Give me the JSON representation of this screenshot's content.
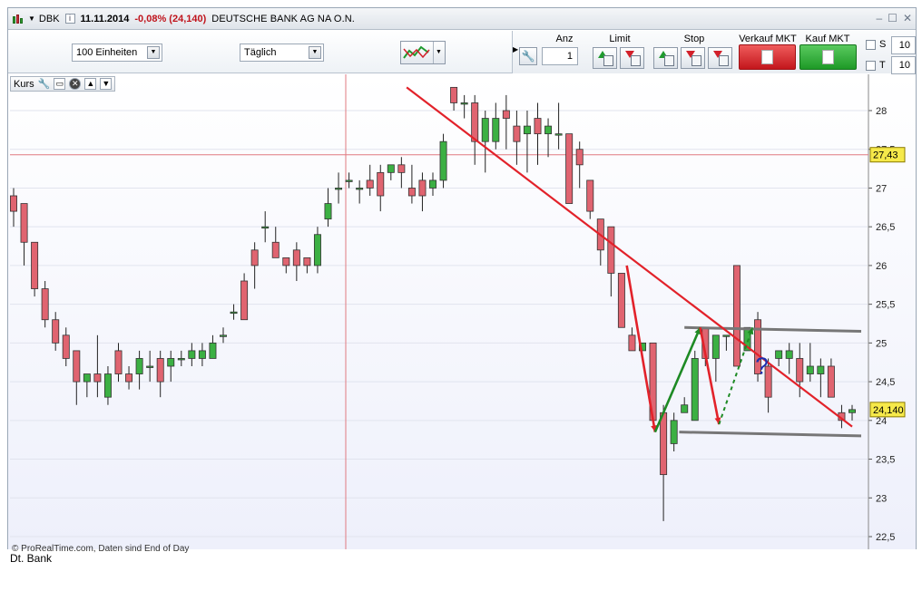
{
  "window": {
    "symbol": "DBK",
    "date": "11.11.2014",
    "change": "-0,08% (24,140)",
    "name": "DEUTSCHE BANK AG NA O.N."
  },
  "toolbar": {
    "quantity_select": "100 Einheiten",
    "interval_select": "Täglich",
    "anz_label": "Anz",
    "anz_value": "1",
    "limit_label": "Limit",
    "stop_label": "Stop",
    "sell_label": "Verkauf MKT",
    "buy_label": "Kauf MKT",
    "s_label": "S",
    "s_value": "10",
    "t_label": "T",
    "t_value": "10"
  },
  "panel": {
    "label": "Kurs"
  },
  "footer": {
    "copyright": "© ProRealTime.com, Daten sind End of Day",
    "caption": "Dt. Bank"
  },
  "colors": {
    "up": "#3cb043",
    "down": "#e06470",
    "trend": "#e2222a",
    "channel": "#777777",
    "pattern_green": "#1d8a24",
    "question": "#1c30b0"
  },
  "chart_data": {
    "type": "candlestick",
    "ylim": [
      22.3,
      28.5
    ],
    "yticks": [
      "28",
      "27,5",
      "27",
      "26,5",
      "26",
      "25,5",
      "25",
      "24,5",
      "24",
      "23,5",
      "23",
      "22,5"
    ],
    "price_labels": [
      "27,43",
      "24,140"
    ],
    "annotation": "?",
    "ohlc": [
      [
        26.9,
        27.0,
        26.5,
        26.7
      ],
      [
        26.8,
        26.8,
        26.0,
        26.3
      ],
      [
        26.3,
        26.3,
        25.6,
        25.7
      ],
      [
        25.7,
        25.8,
        25.2,
        25.3
      ],
      [
        25.3,
        25.4,
        24.9,
        25.0
      ],
      [
        25.1,
        25.2,
        24.7,
        24.8
      ],
      [
        24.9,
        24.9,
        24.2,
        24.5
      ],
      [
        24.5,
        24.6,
        24.3,
        24.6
      ],
      [
        24.6,
        25.1,
        24.3,
        24.5
      ],
      [
        24.3,
        24.7,
        24.2,
        24.6
      ],
      [
        24.9,
        25.0,
        24.5,
        24.6
      ],
      [
        24.6,
        24.7,
        24.4,
        24.5
      ],
      [
        24.6,
        24.9,
        24.4,
        24.8
      ],
      [
        24.7,
        24.9,
        24.5,
        24.7
      ],
      [
        24.8,
        24.9,
        24.3,
        24.5
      ],
      [
        24.7,
        24.9,
        24.5,
        24.8
      ],
      [
        24.8,
        24.9,
        24.7,
        24.8
      ],
      [
        24.8,
        25.0,
        24.7,
        24.9
      ],
      [
        24.8,
        25.0,
        24.7,
        24.9
      ],
      [
        24.8,
        25.1,
        24.8,
        25.0
      ],
      [
        25.1,
        25.2,
        25.0,
        25.1
      ],
      [
        25.4,
        25.5,
        25.3,
        25.4
      ],
      [
        25.8,
        25.9,
        25.3,
        25.3
      ],
      [
        26.2,
        26.3,
        25.7,
        26.0
      ],
      [
        26.5,
        26.7,
        26.3,
        26.5
      ],
      [
        26.3,
        26.5,
        26.1,
        26.1
      ],
      [
        26.1,
        26.1,
        25.9,
        26.0
      ],
      [
        26.2,
        26.3,
        25.8,
        26.0
      ],
      [
        26.1,
        26.1,
        25.9,
        26.0
      ],
      [
        26.0,
        26.5,
        25.9,
        26.4
      ],
      [
        26.6,
        27.0,
        26.5,
        26.8
      ],
      [
        27.0,
        27.2,
        26.8,
        27.0
      ],
      [
        27.1,
        27.2,
        27.0,
        27.1
      ],
      [
        27.0,
        27.1,
        26.8,
        27.0
      ],
      [
        27.1,
        27.3,
        26.9,
        27.0
      ],
      [
        27.2,
        27.3,
        26.7,
        26.9
      ],
      [
        27.2,
        27.3,
        27.1,
        27.3
      ],
      [
        27.3,
        27.4,
        27.0,
        27.2
      ],
      [
        27.0,
        27.3,
        26.8,
        26.9
      ],
      [
        27.1,
        27.2,
        26.7,
        26.9
      ],
      [
        27.0,
        27.2,
        26.9,
        27.1
      ],
      [
        27.1,
        27.7,
        27.0,
        27.6
      ],
      [
        28.3,
        28.3,
        28.0,
        28.1
      ],
      [
        28.1,
        28.2,
        27.9,
        28.1
      ],
      [
        28.1,
        28.2,
        27.3,
        27.6
      ],
      [
        27.6,
        28.0,
        27.2,
        27.9
      ],
      [
        27.6,
        28.1,
        27.5,
        27.9
      ],
      [
        28.0,
        28.2,
        27.5,
        27.9
      ],
      [
        27.8,
        28.0,
        27.3,
        27.6
      ],
      [
        27.7,
        28.0,
        27.2,
        27.8
      ],
      [
        27.9,
        28.1,
        27.3,
        27.7
      ],
      [
        27.7,
        27.9,
        27.4,
        27.8
      ],
      [
        27.7,
        28.1,
        27.5,
        27.7
      ],
      [
        27.7,
        27.7,
        26.8,
        26.8
      ],
      [
        27.5,
        27.6,
        27.0,
        27.3
      ],
      [
        27.1,
        27.1,
        26.6,
        26.7
      ],
      [
        26.6,
        26.6,
        26.0,
        26.2
      ],
      [
        26.5,
        26.5,
        25.6,
        25.9
      ],
      [
        25.9,
        25.9,
        25.2,
        25.2
      ],
      [
        25.1,
        25.2,
        24.9,
        24.9
      ],
      [
        24.9,
        25.0,
        24.9,
        25.0
      ],
      [
        25.0,
        25.0,
        24.1,
        24.0
      ],
      [
        24.1,
        24.2,
        22.7,
        23.3
      ],
      [
        23.7,
        24.1,
        23.6,
        24.0
      ],
      [
        24.1,
        24.3,
        24.1,
        24.2
      ],
      [
        24.0,
        24.9,
        24.0,
        24.8
      ],
      [
        25.2,
        25.2,
        24.7,
        24.8
      ],
      [
        24.8,
        25.1,
        24.5,
        25.1
      ],
      [
        25.1,
        25.1,
        24.9,
        25.1
      ],
      [
        26.0,
        26.0,
        24.7,
        24.7
      ],
      [
        24.9,
        25.2,
        24.9,
        25.2
      ],
      [
        25.3,
        25.4,
        24.5,
        24.6
      ],
      [
        24.7,
        24.8,
        24.1,
        24.3
      ],
      [
        24.8,
        24.9,
        24.7,
        24.9
      ],
      [
        24.8,
        25.0,
        24.6,
        24.9
      ],
      [
        24.8,
        25.0,
        24.3,
        24.5
      ],
      [
        24.6,
        25.0,
        24.5,
        24.7
      ],
      [
        24.6,
        24.8,
        24.3,
        24.7
      ],
      [
        24.7,
        24.8,
        24.3,
        24.3
      ],
      [
        24.1,
        24.2,
        23.9,
        24.0
      ],
      [
        24.1,
        24.2,
        24.0,
        24.14
      ]
    ],
    "trendline": {
      "from": [
        0,
        28.3
      ],
      "to": [
        80,
        23.9
      ]
    },
    "channel_top": {
      "from": [
        0,
        25.2
      ],
      "to": [
        80,
        25.2
      ]
    },
    "channel_bottom": {
      "from": [
        0,
        23.85
      ],
      "to": [
        80,
        23.8
      ]
    }
  }
}
